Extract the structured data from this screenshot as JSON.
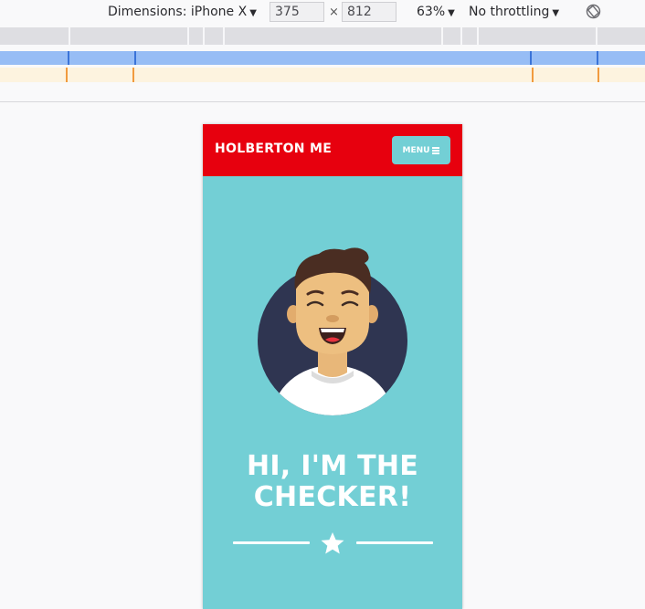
{
  "devtools": {
    "dimensions_label": "Dimensions: iPhone X",
    "width_value": "375",
    "times": "×",
    "height_value": "812",
    "zoom": "63%",
    "throttling": "No throttling",
    "dropdown_arrow": "▼",
    "rotate_icon": "rotate-icon"
  },
  "site": {
    "brand": "HOLBERTON ME",
    "menu_label": "MENU",
    "menu_icon": "hamburger-icon",
    "avatar_icon": "avatar-icon",
    "hero_line1": "HI, I'M THE",
    "hero_line2": "CHECKER!",
    "star_icon": "star-icon"
  },
  "colors": {
    "header_red": "#e7000e",
    "teal": "#73cfd5",
    "navy": "#2f3551",
    "white": "#ffffff"
  }
}
